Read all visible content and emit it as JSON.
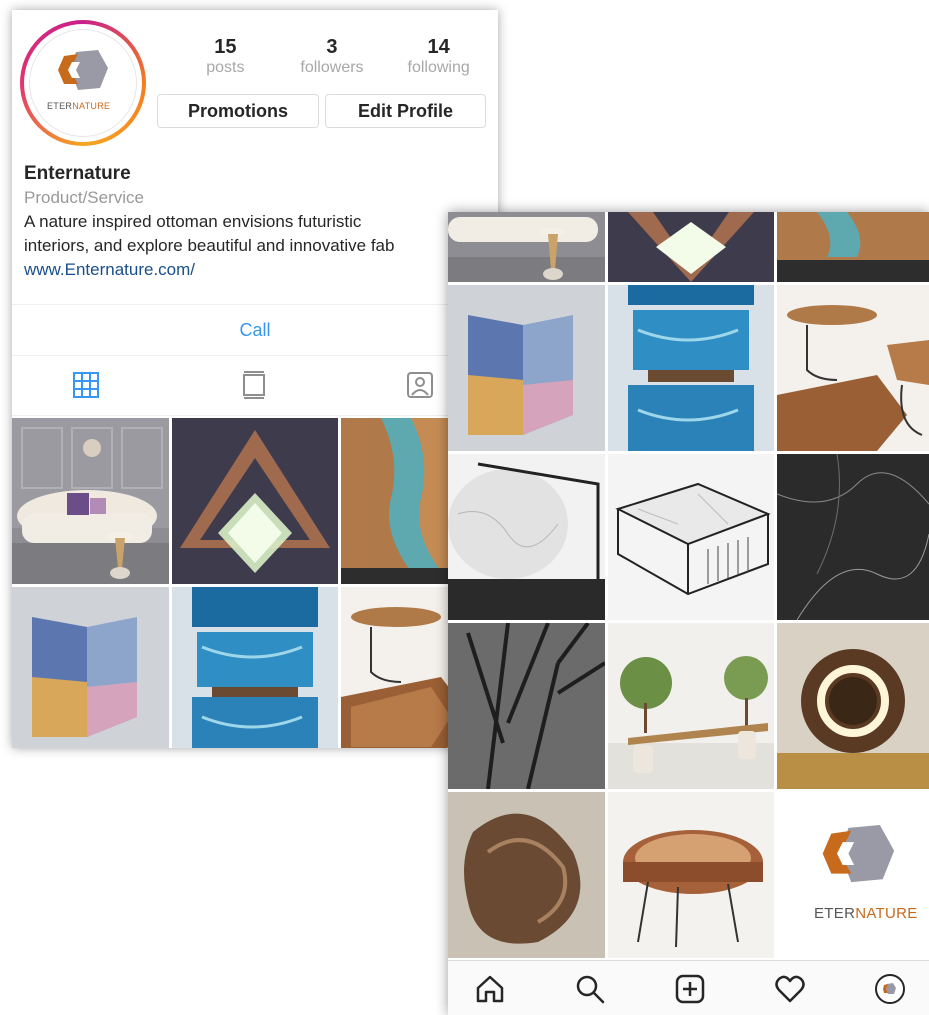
{
  "profile": {
    "logo_text_a": "ETER",
    "logo_text_b": "NATURE",
    "stats": [
      {
        "num": "15",
        "label": "posts"
      },
      {
        "num": "3",
        "label": "followers"
      },
      {
        "num": "14",
        "label": "following"
      }
    ],
    "buttons": {
      "promotions": "Promotions",
      "edit_profile": "Edit Profile"
    },
    "name": "Enternature",
    "category": "Product/Service",
    "bio_line1": "A nature inspired ottoman envisions futuristic",
    "bio_line2": "interiors, and explore beautiful and innovative fab",
    "website": "www.Enternature.com/",
    "call": "Call"
  },
  "tabs": [
    {
      "icon": "grid-icon",
      "active": true
    },
    {
      "icon": "feed-icon",
      "active": false
    },
    {
      "icon": "tagged-icon",
      "active": false
    }
  ],
  "left_grid": [
    "sofa-photo",
    "triangle-lamp-photo",
    "river-table-photo",
    "glass-chair-photo",
    "blue-resin-photo",
    "wood-table-photo"
  ],
  "right_grid": [
    "sofa-photo",
    "triangle-lamp-photo",
    "river-table-photo",
    "glass-chair-photo",
    "blue-resin-photo",
    "wood-side-table-photo",
    "marble-round-table-photo",
    "marble-square-table-photo",
    "black-marble-photo",
    "metal-branches-photo",
    "tree-bench-photo",
    "log-lamp-photo",
    "copper-bowl-chair-photo",
    "wood-slab-stool-photo",
    "eternature-logo-tile"
  ],
  "bottom_nav": [
    "home-icon",
    "search-icon",
    "add-post-icon",
    "heart-icon",
    "profile-avatar-icon"
  ],
  "colors": {
    "link": "#1a4e8c",
    "call": "#3897f0",
    "active_tab": "#3897f0",
    "logo_orange": "#c86a1c",
    "logo_gray": "#8e8e99"
  }
}
